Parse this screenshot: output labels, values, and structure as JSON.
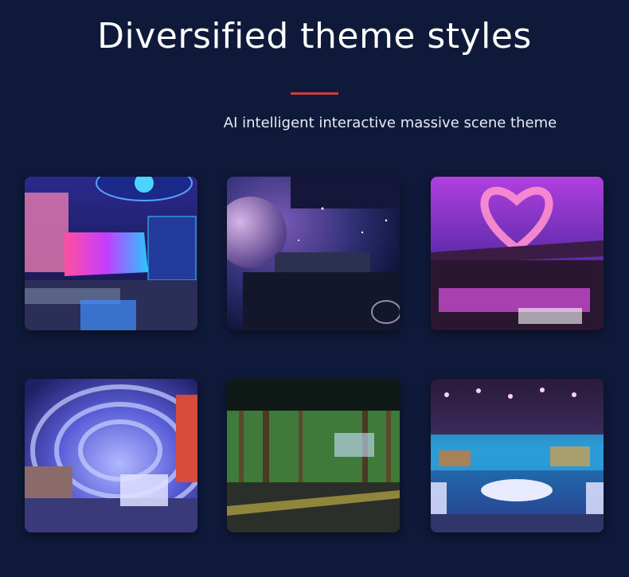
{
  "header": {
    "title": "Diversified theme styles",
    "subtitle": "AI intelligent interactive massive scene theme"
  },
  "gallery": [
    {
      "theme": "cyber-ktv-room"
    },
    {
      "theme": "galaxy-lounge"
    },
    {
      "theme": "heart-sky-room"
    },
    {
      "theme": "neon-ring-room"
    },
    {
      "theme": "forest-room"
    },
    {
      "theme": "ocean-banquet-hall"
    }
  ],
  "colors": {
    "background": "#0f1a3a",
    "accent": "#d23a3f"
  }
}
